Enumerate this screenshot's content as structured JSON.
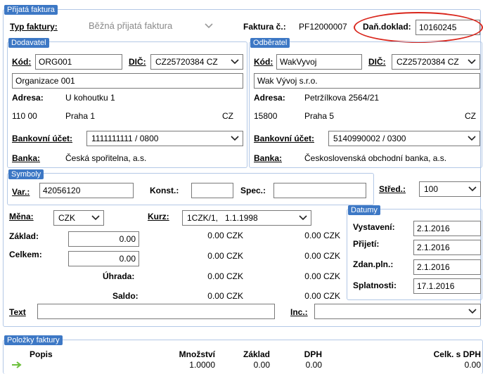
{
  "form_title": "Přijatá faktura",
  "type_row": {
    "label": "Typ faktury:",
    "value": "Běžná přijatá faktura"
  },
  "invoice": {
    "label": "Faktura č.:",
    "value": "PF12000007"
  },
  "tax_doc": {
    "label": "Daň.doklad:",
    "value": "10160245"
  },
  "supplier": {
    "title": "Dodavatel",
    "code_label": "Kód:",
    "code_value": "ORG001",
    "dic_label": "DIČ:",
    "dic_value": "CZ25720384 CZ",
    "name": "Organizace 001",
    "address_label": "Adresa:",
    "street": "U kohoutku 1",
    "zip": "110 00",
    "city": "Praha 1",
    "country": "CZ",
    "bank_account_label": "Bankovní účet:",
    "bank_account_value": "1111111111 / 0800",
    "bank_label": "Banka:",
    "bank_value": "Česká spořitelna, a.s."
  },
  "customer": {
    "title": "Odběratel",
    "code_label": "Kód:",
    "code_value": "WakVyvoj",
    "dic_label": "DIČ:",
    "dic_value": "CZ25720384 CZ",
    "name": "Wak Vývoj s.r.o.",
    "address_label": "Adresa:",
    "street": "Petržílkova 2564/21",
    "zip": "15800",
    "city": "Praha 5",
    "country": "CZ",
    "bank_account_label": "Bankovní účet:",
    "bank_account_value": "5140990002 / 0300",
    "bank_label": "Banka:",
    "bank_value": "Československá obchodní banka, a.s."
  },
  "symbols": {
    "title": "Symboly",
    "var_label": "Var.:",
    "var_value": "42056120",
    "konst_label": "Konst.:",
    "konst_value": "",
    "spec_label": "Spec.:",
    "spec_value": "",
    "stred_label": "Střed.:",
    "stred_value": "100"
  },
  "currency": {
    "mena_label": "Měna:",
    "mena_value": "CZK",
    "kurz_label": "Kurz:",
    "kurz_value": "1CZK/1,   1.1.1998"
  },
  "amounts": {
    "zaklad_label": "Základ:",
    "zaklad_value": "0.00",
    "celkem_label": "Celkem:",
    "celkem_value": "0.00",
    "uhrada_label": "Úhrada:",
    "saldo_label": "Saldo:",
    "col1": [
      "0.00 CZK",
      "0.00 CZK",
      "0.00 CZK",
      "0.00 CZK"
    ],
    "col2": [
      "0.00 CZK",
      "0.00 CZK",
      "0.00 CZK",
      "0.00 CZK"
    ]
  },
  "dates": {
    "title": "Datumy",
    "vystaveni_label": "Vystavení:",
    "vystaveni_value": "2.1.2016",
    "prijeti_label": "Přijetí:",
    "prijeti_value": "2.1.2016",
    "zdan_label": "Zdan.pln.:",
    "zdan_value": "2.1.2016",
    "splatnosti_label": "Splatnosti:",
    "splatnosti_value": "17.1.2016"
  },
  "text_row": {
    "text_label": "Text",
    "text_value": "",
    "inc_label": "Inc.:",
    "inc_value": ""
  },
  "items": {
    "title": "Položky faktury",
    "headers": {
      "popis": "Popis",
      "mnozstvi": "Množství",
      "zaklad": "Základ",
      "dph": "DPH",
      "celk": "Celk. s DPH"
    },
    "row": {
      "mnozstvi": "1.0000",
      "zaklad": "0.00",
      "dph": "0.00",
      "celk": "0.00"
    }
  },
  "colors": {
    "accent": "#3d78c5",
    "border": "#b3c8e6",
    "highlight": "#d9261c"
  }
}
